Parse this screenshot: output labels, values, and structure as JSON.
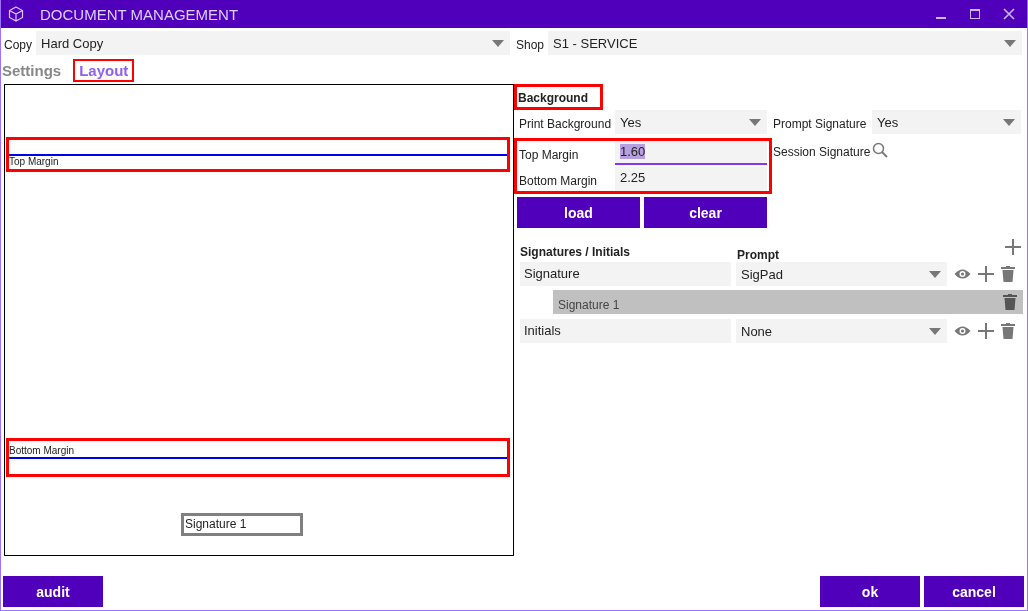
{
  "window": {
    "title": "DOCUMENT MANAGEMENT"
  },
  "copy": {
    "label": "Copy",
    "value": "Hard Copy"
  },
  "shop": {
    "label": "Shop",
    "value": "S1 - SERVICE"
  },
  "tabs": [
    {
      "label": "Settings",
      "selected": false,
      "highlighted": false
    },
    {
      "label": "Layout",
      "selected": true,
      "highlighted": true
    }
  ],
  "canvas": {
    "top_margin": {
      "label": "Top Margin",
      "highlighted": true
    },
    "bottom_margin": {
      "label": "Bottom Margin",
      "highlighted": true
    },
    "signature_boxes": [
      {
        "label": "Signature 1"
      }
    ]
  },
  "background": {
    "heading": "Background",
    "highlighted": true,
    "print_background": {
      "label": "Print Background",
      "value": "Yes"
    },
    "margins_highlighted": true,
    "top_margin": {
      "label": "Top Margin",
      "value": "1.60",
      "focused": true
    },
    "bottom_margin": {
      "label": "Bottom Margin",
      "value": "2.25",
      "focused": false
    }
  },
  "prompt_signature": {
    "label": "Prompt Signature",
    "value": "Yes"
  },
  "session_signature": {
    "label": "Session Signature"
  },
  "load_button": "load",
  "clear_button": "clear",
  "signatures": {
    "heading": "Signatures / Initials",
    "prompt_heading": "Prompt",
    "rows": [
      {
        "name": "Signature",
        "prompt": "SigPad",
        "children": [
          {
            "name": "Signature 1"
          }
        ]
      },
      {
        "name": "Initials",
        "prompt": "None"
      }
    ]
  },
  "footer": {
    "audit": "audit",
    "ok": "ok",
    "cancel": "cancel"
  }
}
